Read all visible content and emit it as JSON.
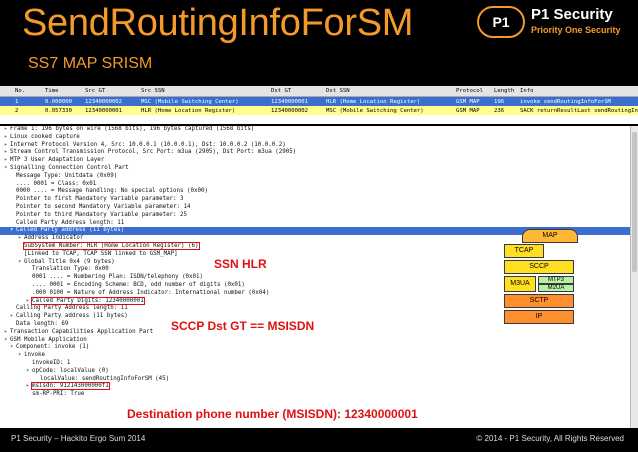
{
  "header": {
    "title": "SendRoutingInfoForSM",
    "subtitle": "SS7 MAP SRISM",
    "logo_badge": "P1",
    "logo_name": "P1 Security",
    "logo_tagline": "Priority One Security"
  },
  "packet_list": {
    "columns": [
      "No.",
      "Time",
      "Src GT",
      "Src SSN",
      "Dst GT",
      "Dst SSN",
      "Protocol",
      "Length",
      "Info"
    ],
    "rows": [
      [
        "1",
        "0.000000",
        "12340000002",
        "MSC (Mobile Switching Center)",
        "12340000001",
        "HLR (Home Location Register)",
        "GSM MAP",
        "196",
        "invoke sendRoutingInfoForSM"
      ],
      [
        "2",
        "0.057330",
        "12340000001",
        "HLR (Home Location Register)",
        "12340000002",
        "MSC (Mobile Switching Center)",
        "GSM MAP",
        "236",
        "SACK returnResultLast sendRoutingInfoForSM"
      ]
    ]
  },
  "tree": {
    "lines": [
      "Frame 1: 196 bytes on wire (1568 bits), 196 bytes captured (1568 bits)",
      "Linux cooked capture",
      "Internet Protocol Version 4, Src: 10.0.0.1 (10.0.0.1), Dst: 10.0.0.2 (10.0.0.2)",
      "Stream Control Transmission Protocol, Src Port: m3ua (2905), Dst Port: m3ua (2905)",
      "MTP 3 User Adaptation Layer",
      "Signalling Connection Control Part",
      "Message Type: Unitdata (0x09)",
      ".... 0001 = Class: 0x01",
      "0000 .... = Message handling: No special options (0x00)",
      "Pointer to first Mandatory Variable parameter: 3",
      "Pointer to second Mandatory Variable parameter: 14",
      "Pointer to third Mandatory Variable parameter: 25",
      "Called Party Address length: 11",
      "Called Party address (11 bytes)",
      "Address Indicator",
      "SubSystem Number: HLR (Home Location Register) (6)",
      "[Linked to TCAP, TCAP SSN linked to GSM_MAP]",
      "Global Title 0x4 (9 bytes)",
      "Translation Type: 0x00",
      "0001 .... = Numbering Plan: ISDN/telephony (0x01)",
      ".... 0001 = Encoding Scheme: BCD, odd number of digits (0x01)",
      ".000 0100 = Nature of Address Indicator: International number (0x04)",
      "Called Party Digits: 12340000001",
      "Calling Party Address length: 11",
      "Calling Party address (11 bytes)",
      "Data length: 69",
      "Transaction Capabilities Application Part",
      "GSM Mobile Application",
      "Component: invoke (1)",
      "invoke",
      "invokeID: 1",
      "opCode: localValue (0)",
      "localValue: sendRoutingInfoForSM (45)",
      "msisdn: 912143000000f1",
      "sm-RP-PRI: True"
    ]
  },
  "annotations": {
    "ssn": "SSN HLR",
    "gt": "SCCP Dst GT == MSISDN",
    "msisdn": "Destination phone number (MSISDN): 12340000001"
  },
  "stack": {
    "map": "MAP",
    "tcap": "TCAP",
    "sccp": "SCCP",
    "m3ua": "M3UA",
    "mtp3": "MTP3",
    "m2ua": "M2UA",
    "sctp": "SCTP",
    "ip": "IP"
  },
  "footer": {
    "left": "P1 Security – Hackito Ergo Sum 2014",
    "right": "© 2014 - P1 Security, All Rights Reserved"
  },
  "colors": {
    "accent": "#f39a2b",
    "selection": "#3a6fd0",
    "highlight_row": "#ffff8c",
    "annotation": "#e01010"
  }
}
